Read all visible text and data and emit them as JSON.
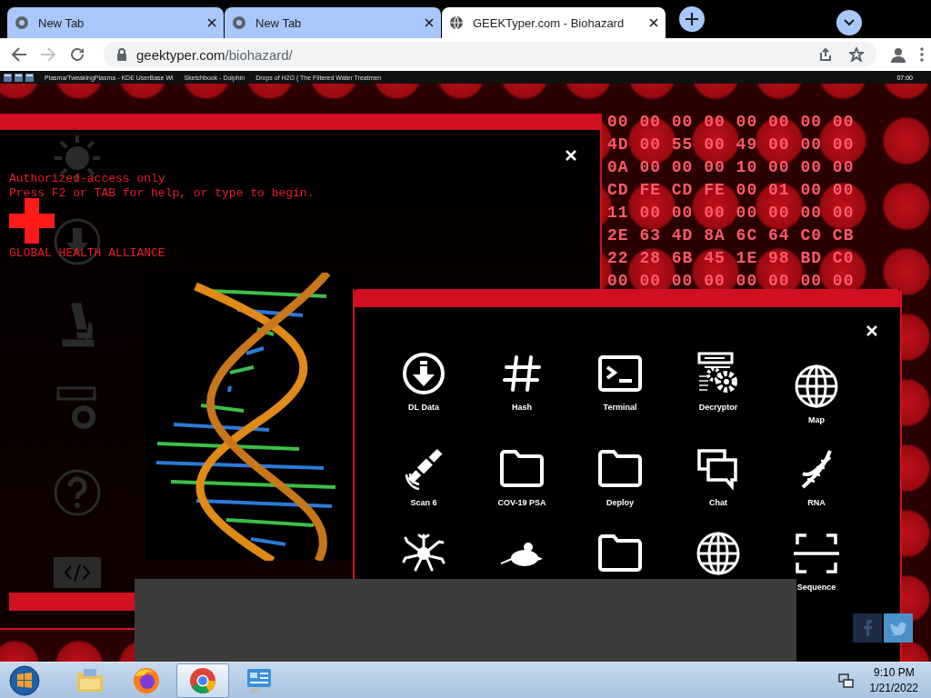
{
  "browser": {
    "tabs": [
      {
        "title": "New Tab",
        "selected": false
      },
      {
        "title": "New Tab",
        "selected": false
      },
      {
        "title": "GEEKTyper.com - Biohazard",
        "selected": true
      }
    ],
    "address": {
      "domain": "geektyper.com",
      "path": "/biohazard/"
    }
  },
  "page": {
    "top_taskbar": {
      "tasks": [
        "Plasma/TweakingPlasma - KDE UserBase Wi",
        "Sketchbook - Dolphin",
        "Drops of H2O ( The Filtered Water Treatmen"
      ],
      "clock": "07:00"
    },
    "terminal_window": {
      "lines": [
        "Authorized-access only",
        "Press F2 or TAB for help, or type to begin."
      ],
      "org": "GLOBAL HEALTH ALLIANCE"
    },
    "hex_dump": {
      "rows": [
        "00 00 00 00 00 00 00 00",
        "4D 00 55 00 49 00 00 00",
        "0A 00 00 00 10 00 00 00",
        "CD FE CD FE 00 01 00 00",
        "11 00 00 00 00 00 00 00",
        "2E 63 4D 8A 6C 64 C0 CB",
        "22 28 6B 45 1E 98 BD C0",
        "00 00 00 00 00 00 00 00"
      ]
    },
    "apps_window": {
      "apps": [
        {
          "kind": "download",
          "label": "DL Data"
        },
        {
          "kind": "hash",
          "label": "Hash"
        },
        {
          "kind": "terminal",
          "label": "Terminal"
        },
        {
          "kind": "decryptor",
          "label": "Decryptor"
        },
        {
          "kind": "globe",
          "label": "Map"
        },
        {
          "kind": "satellite",
          "label": "Scan 6"
        },
        {
          "kind": "folder",
          "label": "COV-19 PSA"
        },
        {
          "kind": "folder",
          "label": "Deploy"
        },
        {
          "kind": "chat",
          "label": "Chat"
        },
        {
          "kind": "dna",
          "label": "RNA"
        },
        {
          "kind": "neuron"
        },
        {
          "kind": "mouse"
        },
        {
          "kind": "folder"
        },
        {
          "kind": "globe"
        },
        {
          "kind": "sequence",
          "label": "Sequence"
        }
      ]
    }
  },
  "taskbar": {
    "apps": [
      {
        "kind": "explorer",
        "selected": false
      },
      {
        "kind": "firefox",
        "selected": false
      },
      {
        "kind": "chrome",
        "selected": true
      },
      {
        "kind": "control-panel",
        "selected": false
      }
    ],
    "time": "9:10 PM",
    "date": "1/21/2022"
  }
}
